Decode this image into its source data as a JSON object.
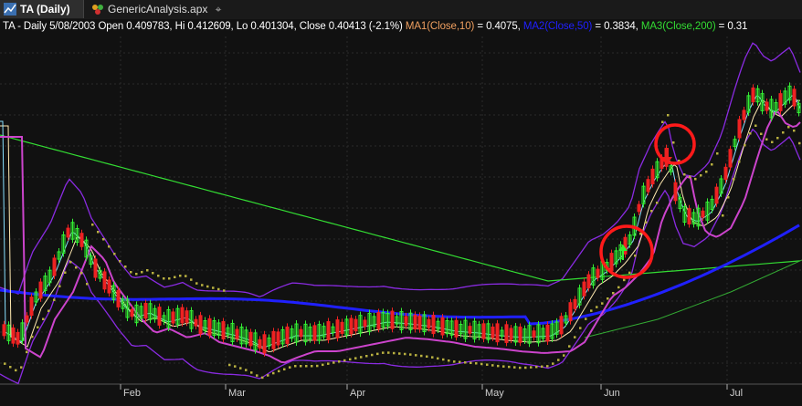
{
  "tabs": [
    {
      "label": "TA (Daily)",
      "icon": "chart-icon",
      "active": true
    },
    {
      "label": "GenericAnalysis.apx",
      "icon": "analysis-icon",
      "active": false
    }
  ],
  "new_tab_icon": "plus-icon",
  "info_line": {
    "prefix": "TA - Daily 5/08/2003 Open 0.409783, Hi 0.412609, Lo 0.401304, Close 0.40413 (-2.1%)",
    "ma1_label": "MA1(Close,10)",
    "ma1_value": " = 0.4075,",
    "ma2_label": "MA2(Close,50)",
    "ma2_value": " = 0.3834,",
    "ma3_label": "MA3(Close,200)",
    "ma3_value": " = 0.31"
  },
  "colors": {
    "up_candle": "#33ee33",
    "down_candle": "#ee2222",
    "ma1": "#f0a060",
    "ma2": "#2020ff",
    "ma3": "#33dd33",
    "bollinger": "#8a2be2",
    "sar": "#b8b040",
    "annotation": "#ff1a1a"
  },
  "chart_data": {
    "type": "line",
    "x_tick_labels": [
      "Feb",
      "Mar",
      "Apr",
      "May",
      "Jun",
      "Jul"
    ],
    "grid": true,
    "annotations": [
      {
        "type": "circle",
        "near": "Jun",
        "signal": "buy-arrow"
      },
      {
        "type": "circle",
        "near": "Jun",
        "signal": "sell-arrow"
      }
    ]
  }
}
